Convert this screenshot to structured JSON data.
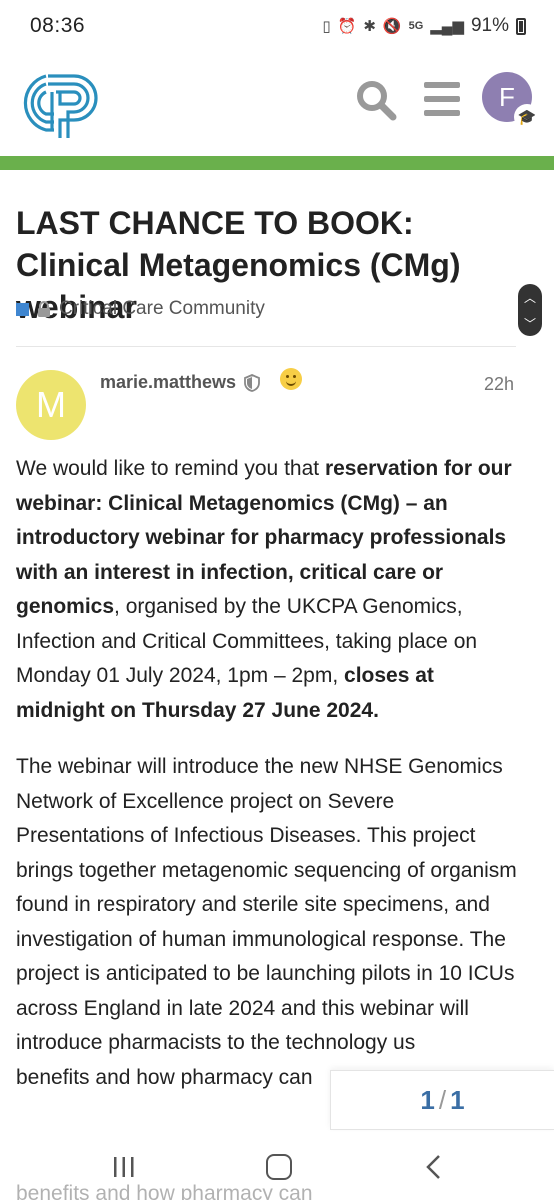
{
  "status": {
    "time": "08:36",
    "network": "5G",
    "battery": "91%"
  },
  "header": {
    "avatar_initial": "F",
    "icons": [
      "logo",
      "search-icon",
      "hamburger-menu-icon",
      "graduation-cap-icon"
    ]
  },
  "topic": {
    "title": "LAST CHANCE TO BOOK: Clinical Metagenomics (CMg) webinar",
    "category": "Critical Care Community",
    "category_color": "#3f86d0"
  },
  "post": {
    "avatar_initial": "M",
    "avatar_color": "#ede46f",
    "username": "marie.matthews",
    "time": "22h",
    "p1": {
      "t1": "We would like to remind you that ",
      "b1": "reservation for our webinar: Clinical Metagenomics (CMg) – an introductory webinar for pharmacy professionals with an interest in infection, critical care or genomics",
      "t2": ", organised by the UKCPA Genomics, Infection and Critical Committees, taking place on Monday 01 July 2024, 1pm – 2pm, ",
      "b2": "closes at midnight on Thursday 27 June 2024."
    },
    "p2": "The webinar will introduce the new NHSE Genomics Network of Excellence project on Severe Presentations of Infectious Diseases. This project brings together metagenomic sequencing of organism found in respiratory and sterile site specimens, and investigation of human immunological response. The project is anticipated to be launching pilots in 10 ICUs across England in late 2024 and this webinar will introduce pharmacists to the technology us",
    "p2_line2": "benefits and how pharmacy can",
    "p2_cut": "benefits and how pharmacy can"
  },
  "progress": {
    "current": "1",
    "total": "1"
  },
  "accent_green": "#6ab04c",
  "link_color": "#3a6ea5"
}
